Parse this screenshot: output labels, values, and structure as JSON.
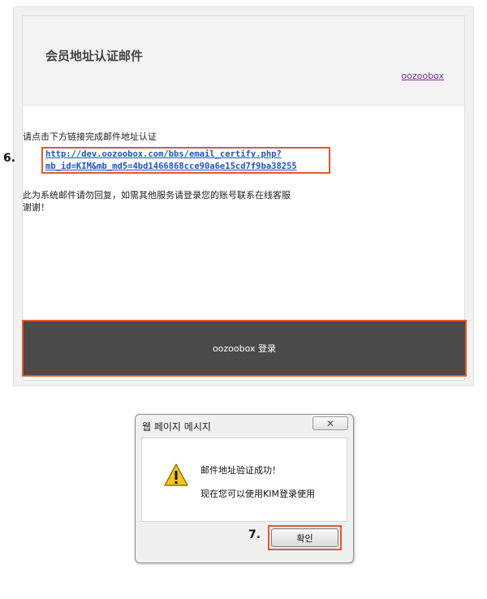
{
  "email": {
    "title": "会员地址认证邮件",
    "brand_link": "oozoobox",
    "instruction": "请点击下方链接完成邮件地址认证",
    "link_line1": "http://dev.oozoobox.com/bbs/email_certify.php?",
    "link_line2": "mb_id=KIM&mb_md5=4bd1466868cce90a6e15cd7f9ba38255",
    "note_line1": "此为系统邮件请勿回复，如需其他服务请登录您的账号联系在线客服",
    "note_line2": "谢谢！",
    "footer_button": "oozoobox 登录",
    "step_label": "6."
  },
  "dialog": {
    "title": "웹 페이지 메시지",
    "close_label": "✕",
    "message_line1": "邮件地址验证成功！",
    "message_line2": "现在您可以使用KIM登录使用",
    "ok_label": "확인",
    "step_label": "7.",
    "icon": "warning-icon"
  },
  "colors": {
    "highlight": "#e05a2a",
    "link": "#1e55c8",
    "footer_bg": "#4a4a4a"
  }
}
